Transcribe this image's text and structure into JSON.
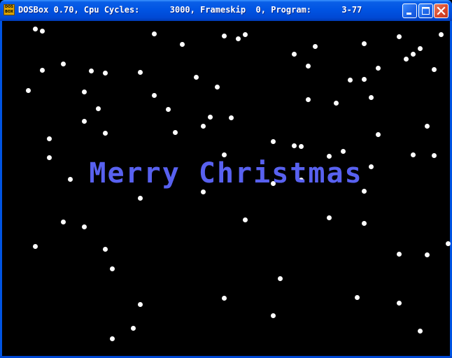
{
  "window": {
    "icon_label": "DOS BOX",
    "title": "DOSBox 0.70, Cpu Cycles:      3000, Frameskip  0, Program:      3-77",
    "colors": {
      "titlebar": "#0054e3",
      "close": "#d8462a",
      "screen": "#000000"
    }
  },
  "controls": {
    "minimize": "minimize-icon",
    "maximize": "maximize-icon",
    "close": "close-icon"
  },
  "screen": {
    "greeting": "Merry Christmas",
    "greeting_color": "#5861f0",
    "snow_color": "#ffffff"
  }
}
